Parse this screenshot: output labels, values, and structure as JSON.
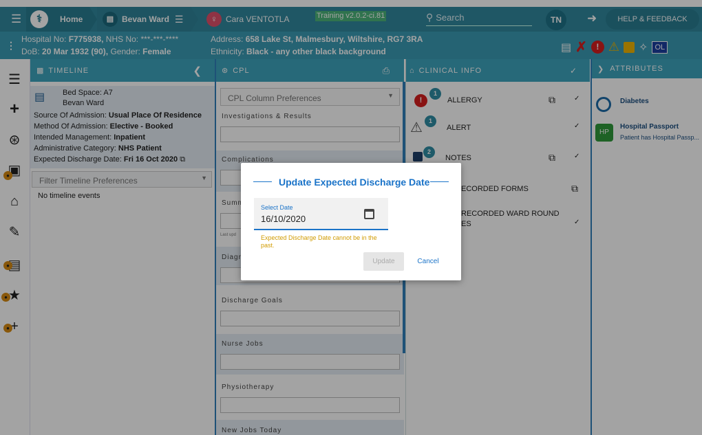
{
  "nav": {
    "home": "Home",
    "ward": "Bevan Ward",
    "patient": "Cara VENTOTLA",
    "training": "Training v2.0.2-ci.81",
    "search_placeholder": "Search",
    "user_initials": "TN",
    "help": "HELP & FEEDBACK"
  },
  "patient": {
    "hospital_no_label": "Hospital No:",
    "hospital_no": "F775938,",
    "nhs_label": "NHS No:",
    "nhs_no": "***-***-****",
    "dob_label": "DoB:",
    "dob": "20 Mar 1932 (90),",
    "gender_label": "Gender:",
    "gender": "Female",
    "address_label": "Address:",
    "address": "658 Lake St, Malmesbury, Wiltshire, RG7 3RA",
    "ethnicity_label": "Ethnicity:",
    "ethnicity": "Black - any other black background",
    "ol_badge": "OL"
  },
  "timeline": {
    "title": "TIMELINE",
    "bed_space": "Bed Space: A7",
    "ward": "Bevan Ward",
    "source_label": "Source Of Admission:",
    "source": "Usual Place Of Residence",
    "method_label": "Method Of Admission:",
    "method": "Elective - Booked",
    "management_label": "Intended Management:",
    "management": "Inpatient",
    "category_label": "Administrative Category:",
    "category": "NHS Patient",
    "discharge_label": "Expected Discharge Date:",
    "discharge": "Fri 16 Oct 2020",
    "filter_placeholder": "Filter Timeline Preferences",
    "empty": "No timeline events"
  },
  "cpl": {
    "title": "CPL",
    "column_prefs": "CPL Column Preferences",
    "sections": {
      "investigations": "Investigations & Results",
      "complications": "Complications",
      "summary": "Summ",
      "last_updated": "Last upd",
      "diagnosis": "Diagn",
      "discharge_goals": "Discharge Goals",
      "nurse_jobs": "Nurse Jobs",
      "physiotherapy": "Physiotherapy",
      "new_jobs": "New Jobs Today"
    }
  },
  "clinical": {
    "title": "CLINICAL INFO",
    "allergy": "ALLERGY",
    "allergy_count": "1",
    "alert": "ALERT",
    "alert_count": "1",
    "notes": "NOTES",
    "notes_count": "2",
    "recorded_forms": "ECORDED FORMS",
    "ward_round_1": "RECORDED WARD ROUND",
    "ward_round_2": "ES"
  },
  "attributes": {
    "title": "ATTRIBUTES",
    "diabetes": "Diabetes",
    "hp_badge": "HP",
    "passport_title": "Hospital Passport",
    "passport_desc": "Patient has Hospital Passp..."
  },
  "dialog": {
    "title": "Update Expected Discharge Date",
    "field_label": "Select Date",
    "field_value": "16/10/2020",
    "error": "Expected Discharge Date cannot be in the past.",
    "update": "Update",
    "cancel": "Cancel"
  },
  "colors": {
    "topbar": "#31889e",
    "infobar": "#3b9cb4",
    "panel_head": "#3ea5bd",
    "accent_blue": "#1a73c8",
    "warning_text": "#d19b00",
    "lock_orange": "#d68a12"
  }
}
